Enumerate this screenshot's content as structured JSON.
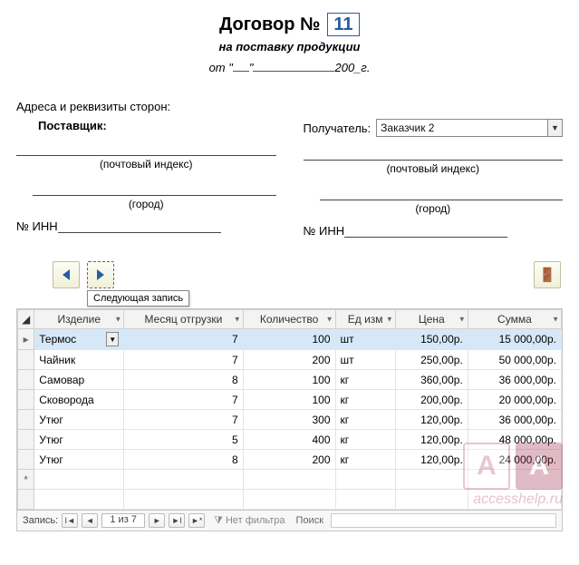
{
  "header": {
    "title_label": "Договор №",
    "contract_number": "11",
    "subtitle": "на поставку продукции",
    "date_prefix": "от \"",
    "date_mid": "\"",
    "date_suffix": "200_г."
  },
  "addresses": {
    "heading": "Адреса и реквизиты сторон:",
    "supplier_label": "Поставщик:",
    "recipient_label": "Получатель:",
    "recipient_value": "Заказчик 2",
    "postal_caption": "(почтовый индекс)",
    "city_caption": "(город)",
    "inn_label": "№ ИНН"
  },
  "nav": {
    "tooltip": "Следующая запись"
  },
  "grid": {
    "columns": [
      "Изделие",
      "Месяц отгрузки",
      "Количество",
      "Ед изм",
      "Цена",
      "Сумма"
    ],
    "rows": [
      {
        "item": "Термос",
        "month": "7",
        "qty": "100",
        "unit": "шт",
        "price": "150,00р.",
        "sum": "15 000,00р."
      },
      {
        "item": "Чайник",
        "month": "7",
        "qty": "200",
        "unit": "шт",
        "price": "250,00р.",
        "sum": "50 000,00р."
      },
      {
        "item": "Самовар",
        "month": "8",
        "qty": "100",
        "unit": "кг",
        "price": "360,00р.",
        "sum": "36 000,00р."
      },
      {
        "item": "Сковорода",
        "month": "7",
        "qty": "100",
        "unit": "кг",
        "price": "200,00р.",
        "sum": "20 000,00р."
      },
      {
        "item": "Утюг",
        "month": "7",
        "qty": "300",
        "unit": "кг",
        "price": "120,00р.",
        "sum": "36 000,00р."
      },
      {
        "item": "Утюг",
        "month": "5",
        "qty": "400",
        "unit": "кг",
        "price": "120,00р.",
        "sum": "48 000,00р."
      },
      {
        "item": "Утюг",
        "month": "8",
        "qty": "200",
        "unit": "кг",
        "price": "120,00р.",
        "sum": "24 000,00р."
      }
    ]
  },
  "recordbar": {
    "label": "Запись:",
    "position": "1 из 7",
    "filter": "Нет фильтра",
    "search": "Поиск"
  },
  "watermark": {
    "url": "accesshelp.ru"
  }
}
